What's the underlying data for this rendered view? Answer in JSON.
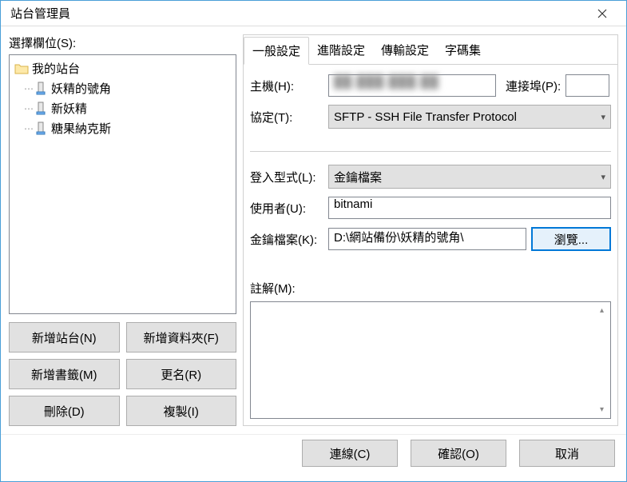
{
  "window": {
    "title": "站台管理員"
  },
  "left": {
    "select_label": "選擇欄位(S):",
    "root": "我的站台",
    "sites": [
      "妖精的號角",
      "新妖精",
      "糖果納克斯"
    ],
    "buttons": {
      "new_site": "新增站台(N)",
      "new_folder": "新增資料夾(F)",
      "new_bookmark": "新增書籤(M)",
      "rename": "更名(R)",
      "delete": "刪除(D)",
      "copy": "複製(I)"
    }
  },
  "tabs": {
    "general": "一般設定",
    "advanced": "進階設定",
    "transfer": "傳輸設定",
    "charset": "字碼集"
  },
  "form": {
    "host_label": "主機(H):",
    "host_value": "██.███.███.██",
    "port_label": "連接埠(P):",
    "port_value": "",
    "protocol_label": "協定(T):",
    "protocol_value": "SFTP - SSH File Transfer Protocol",
    "logon_label": "登入型式(L):",
    "logon_value": "金鑰檔案",
    "user_label": "使用者(U):",
    "user_value": "bitnami",
    "key_label": "金鑰檔案(K):",
    "key_value": "D:\\網站備份\\妖精的號角\\",
    "browse": "瀏覽...",
    "comment_label": "註解(M):",
    "comment_value": ""
  },
  "footer": {
    "connect": "連線(C)",
    "ok": "確認(O)",
    "cancel": "取消"
  }
}
